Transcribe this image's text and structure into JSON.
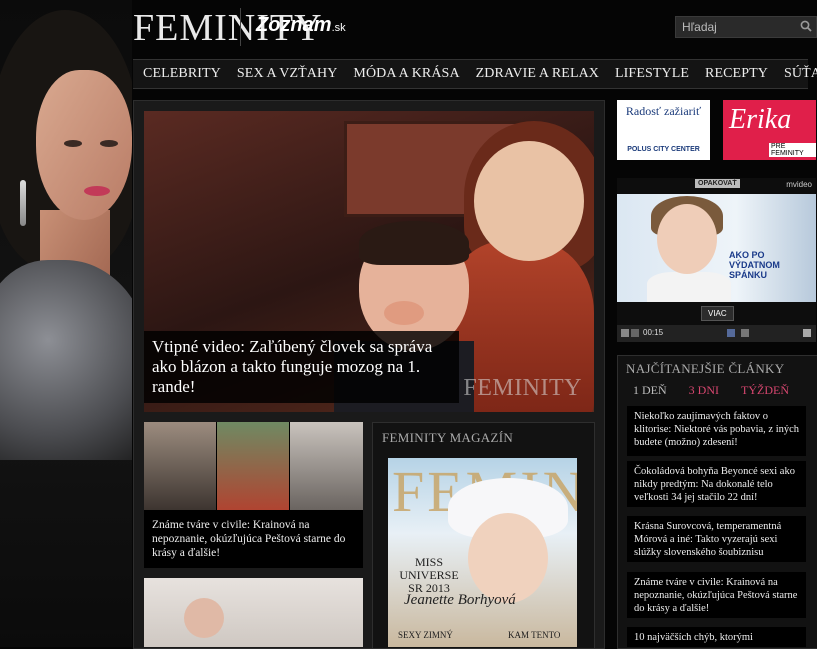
{
  "header": {
    "logo": "FEMINITY",
    "partner_logo": "Zoznam",
    "partner_logo_suffix": ".sk",
    "search_placeholder": "Hľadaj"
  },
  "nav": {
    "items": [
      "CELEBRITY",
      "SEX A VZŤAHY",
      "MÓDA A KRÁSA",
      "ZDRAVIE A RELAX",
      "LIFESTYLE",
      "RECEPTY",
      "SÚŤAŽE"
    ]
  },
  "hero": {
    "title": "Vtipné video: Zaľúbený človek sa správa ako blázon a takto funguje mozog na 1. rande!",
    "watermark": "FEMINITY"
  },
  "articles": [
    {
      "title": "Známe tváre v civile: Krainová na nepoznanie, okúzľujúca Peštová starne do krásy a ďalšie!"
    }
  ],
  "magazine": {
    "heading": "FEMINITY MAGAZÍN",
    "cover_masthead": "FEMINITY",
    "cover_headline": "MISS UNIVERSE SR 2013",
    "cover_signature": "Jeanette Borhyová",
    "cover_sub1": "SEXY ZIMNÝ",
    "cover_sub2": "KAM TENTO"
  },
  "ads": {
    "polus_text": "Radosť zažiariť",
    "polus_brand": "POLUS CITY CENTER",
    "erika_text": "Erika",
    "erika_sub": "PRE FEMINITY"
  },
  "video": {
    "replay_label": "OPAKOVAŤ",
    "brand": "mvideo",
    "ad_text": "AKO PO VÝDATNOM SPÁNKU",
    "more_label": "VIAC",
    "time": "00:15"
  },
  "most_read": {
    "heading": "NAJČÍTANEJŠIE ČLÁNKY",
    "tabs": [
      "1 DEŇ",
      "3 DNI",
      "TÝŽDEŇ"
    ],
    "items": [
      "Niekoľko zaujímavých faktov o klitorise: Niektoré vás pobavia, z iných budete (možno) zdesení!",
      "Čokoládová bohyňa Beyoncé sexi ako nikdy predtým: Na dokonalé telo veľkosti 34 jej stačilo 22 dní!",
      "Krásna Surovcová, temperamentná Mórová a iné: Takto vyzerajú sexi slúžky slovenského šoubiznisu",
      "Známe tváre v civile: Krainová na nepoznanie, okúzľujúca Peštová starne do krásy a ďalšie!",
      "10 najväčších chýb, ktorými"
    ]
  }
}
